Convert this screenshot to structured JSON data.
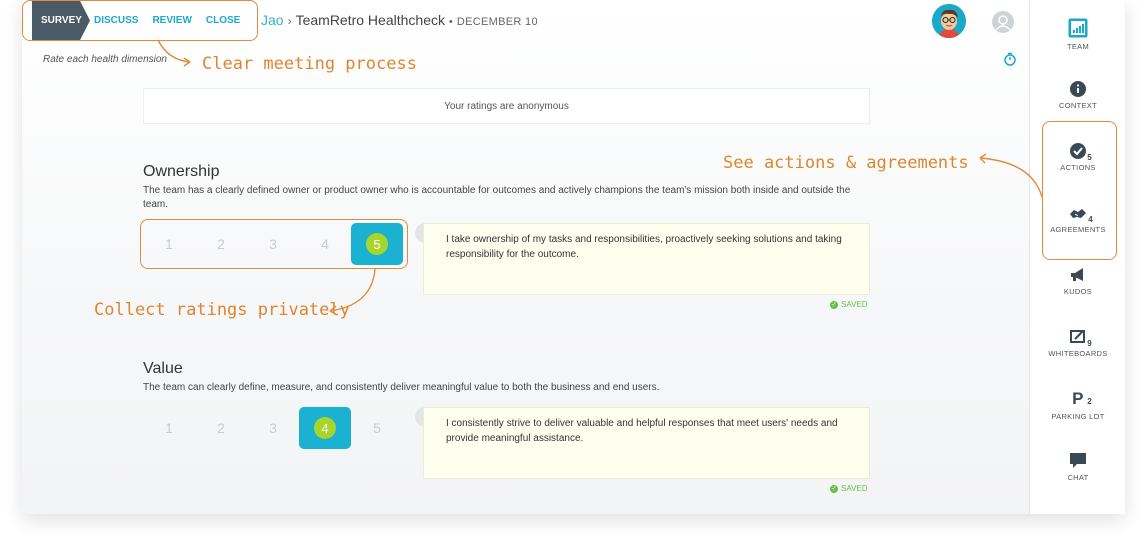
{
  "nav": {
    "steps": [
      "SURVEY",
      "DISCUSS",
      "REVIEW",
      "CLOSE"
    ],
    "active_step": "SURVEY"
  },
  "breadcrumb": {
    "user": "Jao",
    "separator": "›",
    "title": "TeamRetro Healthcheck",
    "dot": "•",
    "date": "DECEMBER 10"
  },
  "subtitle": "Rate each health dimension",
  "anonymous_notice": "Your ratings are anonymous",
  "dimensions": [
    {
      "title": "Ownership",
      "description": "The team has a clearly defined owner or product owner who is accountable for outcomes and actively champions the team's mission both inside and outside the team.",
      "ratings": [
        "1",
        "2",
        "3",
        "4",
        "5"
      ],
      "selected_rating": 5,
      "comment": "I take ownership of my tasks and responsibilities, proactively seeking solutions and taking responsibility for the outcome.",
      "status": "SAVED"
    },
    {
      "title": "Value",
      "description": "The team can clearly define, measure, and consistently deliver meaningful value to both the business and end users.",
      "ratings": [
        "1",
        "2",
        "3",
        "4",
        "5"
      ],
      "selected_rating": 4,
      "comment": "I consistently strive to deliver valuable and helpful responses that meet users' needs and provide meaningful assistance.",
      "status": "SAVED"
    }
  ],
  "sidebar": {
    "items": [
      {
        "label": "TEAM",
        "icon": "team-chart-icon",
        "badge": ""
      },
      {
        "label": "CONTEXT",
        "icon": "info-icon",
        "badge": ""
      },
      {
        "label": "ACTIONS",
        "icon": "check-circle-icon",
        "badge": "5"
      },
      {
        "label": "AGREEMENTS",
        "icon": "handshake-icon",
        "badge": "4"
      },
      {
        "label": "KUDOS",
        "icon": "megaphone-icon",
        "badge": ""
      },
      {
        "label": "WHITEBOARDS",
        "icon": "whiteboard-icon",
        "badge": "9"
      },
      {
        "label": "PARKING LOT",
        "icon": "parking-icon",
        "badge": "2"
      },
      {
        "label": "CHAT",
        "icon": "chat-bubble-icon",
        "badge": ""
      }
    ]
  },
  "annotations": {
    "process": "Clear meeting process",
    "actions": "See actions & agreements",
    "ratings": "Collect ratings privately"
  },
  "colors": {
    "accent": "#1aa9c9",
    "annotation": "#e0852d",
    "rating_dot": "#a8d52a",
    "saved": "#6abf4b"
  }
}
